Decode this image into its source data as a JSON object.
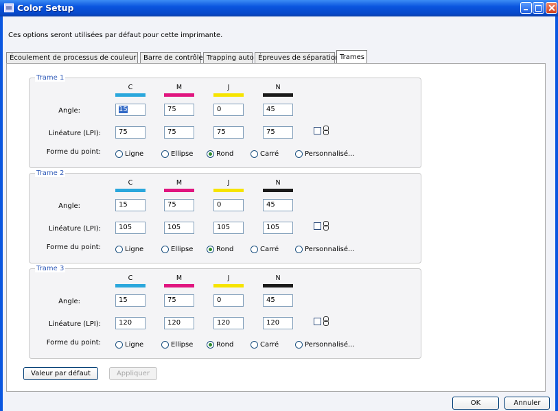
{
  "window": {
    "title": "Color Setup"
  },
  "description": "Ces options seront utilisées par défaut pour cette imprimante.",
  "tabs": [
    {
      "label": "Écoulement de processus de couleur",
      "active": false
    },
    {
      "label": "Barre de contrôle",
      "active": false
    },
    {
      "label": "Trapping auto",
      "active": false
    },
    {
      "label": "Épreuves de séparation",
      "active": false
    },
    {
      "label": "Trames",
      "active": true
    }
  ],
  "inks": [
    {
      "label": "C",
      "color": "#2aa7dc"
    },
    {
      "label": "M",
      "color": "#e0157f"
    },
    {
      "label": "J",
      "color": "#f6e400"
    },
    {
      "label": "N",
      "color": "#1a1a1a"
    }
  ],
  "labels": {
    "angle": "Angle:",
    "lineature": "Linéature (LPI):",
    "dot_shape": "Forme du point:"
  },
  "dot_shapes": [
    "Ligne",
    "Ellipse",
    "Rond",
    "Carré",
    "Personnalisé..."
  ],
  "screens": [
    {
      "title": "Trame 1",
      "angles": [
        "15",
        "75",
        "0",
        "45"
      ],
      "lpi": [
        "75",
        "75",
        "75",
        "75"
      ],
      "dot_shape": "Rond"
    },
    {
      "title": "Trame 2",
      "angles": [
        "15",
        "75",
        "0",
        "45"
      ],
      "lpi": [
        "105",
        "105",
        "105",
        "105"
      ],
      "dot_shape": "Rond"
    },
    {
      "title": "Trame 3",
      "angles": [
        "15",
        "75",
        "0",
        "45"
      ],
      "lpi": [
        "120",
        "120",
        "120",
        "120"
      ],
      "dot_shape": "Rond"
    }
  ],
  "buttons": {
    "default": "Valeur par défaut",
    "apply": "Appliquer",
    "ok": "OK",
    "cancel": "Annuler"
  }
}
